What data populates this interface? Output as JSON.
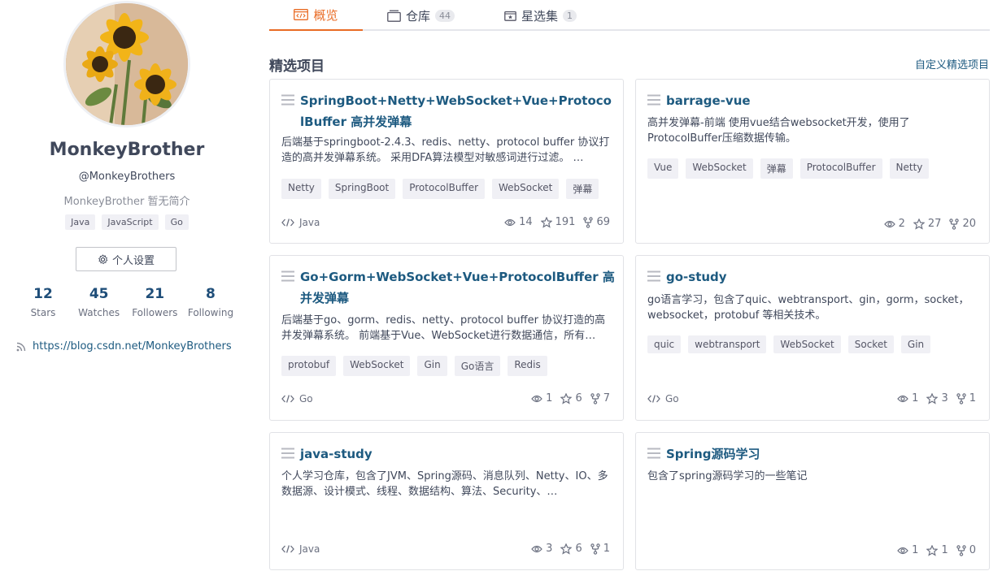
{
  "profile": {
    "display_name": "MonkeyBrother",
    "handle": "@MonkeyBrothers",
    "bio": "MonkeyBrother 暂无简介",
    "languages": [
      "Java",
      "JavaScript",
      "Go"
    ],
    "settings_label": "个人设置",
    "stats": [
      {
        "value": "12",
        "label": "Stars"
      },
      {
        "value": "45",
        "label": "Watches"
      },
      {
        "value": "21",
        "label": "Followers"
      },
      {
        "value": "8",
        "label": "Following"
      }
    ],
    "blog_url": "https://blog.csdn.net/MonkeyBrothers"
  },
  "tabs": [
    {
      "label": "概览",
      "icon": "code-window-icon",
      "count": ""
    },
    {
      "label": "仓库",
      "icon": "repo-icon",
      "count": "44"
    },
    {
      "label": "星选集",
      "icon": "star-collection-icon",
      "count": "1"
    }
  ],
  "main": {
    "section_title": "精选项目",
    "customize_label": "自定义精选项目"
  },
  "colors": {
    "accent": "#e96b24",
    "link": "#1d5a80",
    "text": "#40485b"
  },
  "projects": [
    {
      "title": "SpringBoot+Netty+WebSocket+Vue+ProtocolBuffer 高并发弹幕",
      "description": "后端基于springboot-2.4.3、redis、netty、protocol buffer 协议打造的高并发弹幕系统。 采用DFA算法模型对敏感词进行过滤。 …",
      "tags": [
        "Netty",
        "SpringBoot",
        "ProtocolBuffer",
        "WebSocket",
        "弹幕"
      ],
      "language": "Java",
      "watches": "14",
      "stars": "191",
      "forks": "69"
    },
    {
      "title": "barrage-vue",
      "description": "高并发弹幕-前端 使用vue结合websocket开发，使用了ProtocolBuffer压缩数据传输。",
      "tags": [
        "Vue",
        "WebSocket",
        "弹幕",
        "ProtocolBuffer",
        "Netty"
      ],
      "language": "",
      "watches": "2",
      "stars": "27",
      "forks": "20"
    },
    {
      "title": "Go+Gorm+WebSocket+Vue+ProtocolBuffer 高并发弹幕",
      "description": "后端基于go、gorm、redis、netty、protocol buffer 协议打造的高并发弹幕系统。 前端基于Vue、WebSocket进行数据通信，所有…",
      "tags": [
        "protobuf",
        "WebSocket",
        "Gin",
        "Go语言",
        "Redis"
      ],
      "language": "Go",
      "watches": "1",
      "stars": "6",
      "forks": "7"
    },
    {
      "title": "go-study",
      "description": "go语言学习，包含了quic、webtransport、gin，gorm，socket，websocket，protobuf 等相关技术。",
      "tags": [
        "quic",
        "webtransport",
        "WebSocket",
        "Socket",
        "Gin"
      ],
      "language": "Go",
      "watches": "1",
      "stars": "3",
      "forks": "1"
    },
    {
      "title": "java-study",
      "description": "个人学习仓库，包含了JVM、Spring源码、消息队列、Netty、IO、多数据源、设计模式、线程、数据结构、算法、Security、…",
      "tags": [],
      "language": "Java",
      "watches": "3",
      "stars": "6",
      "forks": "1"
    },
    {
      "title": "Spring源码学习",
      "description": "包含了spring源码学习的一些笔记",
      "tags": [],
      "language": "",
      "watches": "1",
      "stars": "1",
      "forks": "0"
    }
  ]
}
